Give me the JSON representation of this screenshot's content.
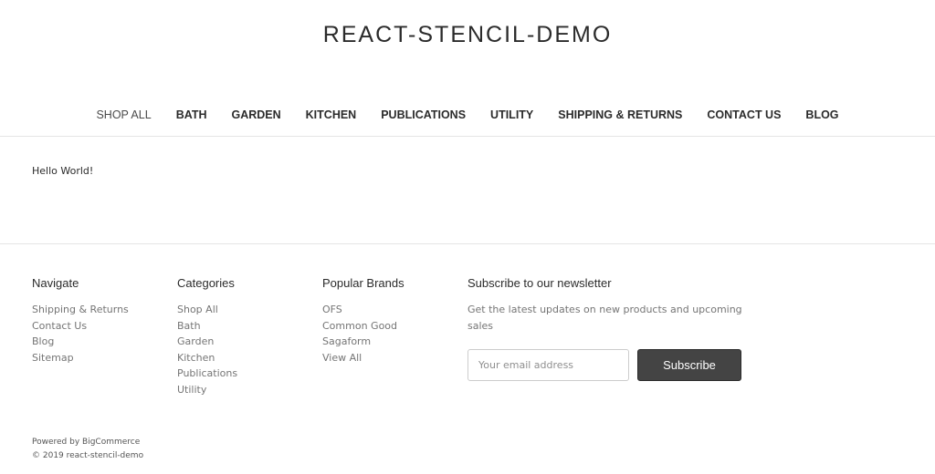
{
  "header": {
    "site_title": "REACT-STENCIL-DEMO"
  },
  "nav": {
    "items": [
      {
        "label": "SHOP ALL",
        "active": true
      },
      {
        "label": "BATH"
      },
      {
        "label": "GARDEN"
      },
      {
        "label": "KITCHEN"
      },
      {
        "label": "PUBLICATIONS"
      },
      {
        "label": "UTILITY"
      },
      {
        "label": "SHIPPING & RETURNS"
      },
      {
        "label": "CONTACT US"
      },
      {
        "label": "BLOG"
      }
    ]
  },
  "main": {
    "text": "Hello World!"
  },
  "footer": {
    "navigate": {
      "heading": "Navigate",
      "links": [
        "Shipping & Returns",
        "Contact Us",
        "Blog",
        "Sitemap"
      ]
    },
    "categories": {
      "heading": "Categories",
      "links": [
        "Shop All",
        "Bath",
        "Garden",
        "Kitchen",
        "Publications",
        "Utility"
      ]
    },
    "brands": {
      "heading": "Popular Brands",
      "links": [
        "OFS",
        "Common Good",
        "Sagaform",
        "View All"
      ]
    },
    "newsletter": {
      "heading": "Subscribe to our newsletter",
      "description": "Get the latest updates on new products and upcoming sales",
      "email_placeholder": "Your email address",
      "subscribe_label": "Subscribe"
    },
    "powered_by": "Powered by BigCommerce",
    "copyright": "© 2019 react-stencil-demo"
  }
}
